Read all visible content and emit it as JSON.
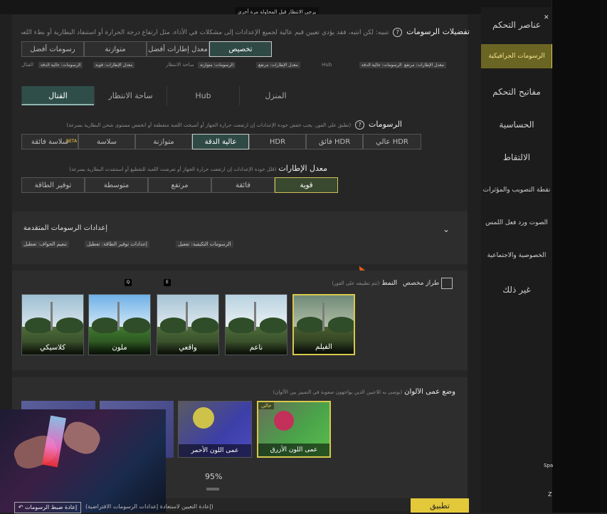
{
  "top": {
    "toast": "يرجى الانتظار قبل المحاولة مرة أخرى"
  },
  "sidebar": {
    "items": [
      {
        "label": "عناصر التحكم",
        "active": false
      },
      {
        "label": "الرسومات الجرافيكية",
        "active": true
      },
      {
        "label": "مفاتيح التحكم",
        "active": false
      },
      {
        "label": "الحساسية",
        "active": false
      },
      {
        "label": "الالتقاط",
        "active": false
      },
      {
        "label": "نقطة التصويب والمؤثرات",
        "active": false
      },
      {
        "label": "الصوت ورد فعل اللمس",
        "active": false
      },
      {
        "label": "الخصوصية والاجتماعية",
        "active": false
      },
      {
        "label": "غير ذلك",
        "active": false
      }
    ]
  },
  "preferences": {
    "title": "تفضيلات الرسومات",
    "warning": "تنبيه: لكن انتبه، فقد يؤدي تعيين قيم عالية لجميع الإعدادات إلى مشكلات في الأداء، مثل ارتفاع درجة الحرارة أو استنفاد البطارية أو بطء اللعب",
    "presets": [
      {
        "label": "تخصيص",
        "on": true
      },
      {
        "label": "معدل إطارات أفضل",
        "on": false
      },
      {
        "label": "متوازنة",
        "on": false
      },
      {
        "label": "رسومات أفضل",
        "on": false
      }
    ],
    "summary_tags": [
      "معدل الإطارات: مرتفع",
      "الرسومات: عالية الدقة",
      "Hub",
      "معدل الإطارات: مرتفع",
      "الرسومات: متوازنة",
      "ساحة الانتظار",
      "معدل الإطارات: قوية",
      "الرسومات: عالية الدقة",
      "القتال"
    ]
  },
  "mode_tabs": [
    {
      "label": "المنزل",
      "on": false
    },
    {
      "label": "Hub",
      "on": false
    },
    {
      "label": "ساحة الانتظار",
      "on": false
    },
    {
      "label": "القتال",
      "on": true
    }
  ],
  "graphics": {
    "title": "الرسومات",
    "hint": "(تطبق على الفور، يجب خفض جودة الإعدادات إن ارتفعت حرارة الجهاز أو أصبحت اللعبة متقطعة أو انخفض مستوى شحن البطارية بسرعة)",
    "options": [
      {
        "label": "عالي HDR",
        "on": false
      },
      {
        "label": "فائق HDR",
        "on": false
      },
      {
        "label": "HDR",
        "on": false
      },
      {
        "label": "عالية الدقة",
        "on": true
      },
      {
        "label": "متوازنة",
        "on": false
      },
      {
        "label": "سلاسة",
        "on": false
      },
      {
        "label": "سلاسة فائقة",
        "on": false,
        "badge": "BETA"
      }
    ]
  },
  "framerate": {
    "title": "معدل الإطارات",
    "hint": "(قلل جودة الإعدادات إن ارتفعت حرارة الجهاز أو تعرضت اللعبة للتقطيع أو استنفدت البطارية بسرعة)",
    "options": [
      {
        "label": "قوية",
        "on": true
      },
      {
        "label": "فائقة",
        "on": false
      },
      {
        "label": "مرتفع",
        "on": false
      },
      {
        "label": "متوسطة",
        "on": false
      },
      {
        "label": "توفير الطاقة",
        "on": false
      }
    ]
  },
  "advanced": {
    "title": "إعدادات الرسومات المتقدمة",
    "tags": [
      "الرسومات التكيفية: تفعيل",
      "إعدادات توفير الطاقة: تعطيل",
      "تنعيم الحواف: تعطيل"
    ]
  },
  "style": {
    "title": "النمط",
    "hint": "(تتم تطبيقه على الفور)",
    "custom_label": "طراز مخصص",
    "key_q": "Q",
    "key_e": "E",
    "thumbs": [
      {
        "label": "الفيلم",
        "selected": true
      },
      {
        "label": "ناعم",
        "selected": false
      },
      {
        "label": "واقعي",
        "selected": false
      },
      {
        "label": "ملون",
        "selected": false
      },
      {
        "label": "كلاسيكي",
        "selected": false
      }
    ]
  },
  "colorblind": {
    "title": "وضع عمى الألوان",
    "hint": "(يوصى به للاعبين الذين يواجهون صعوبة في التمييز بين الألوان)",
    "current_badge": "حالي",
    "options": [
      {
        "label": "عمى اللون الأزرق",
        "selected": true
      },
      {
        "label": "عمى اللون الأحمر",
        "selected": false
      }
    ],
    "brightness": "95%"
  },
  "footer": {
    "reset": "إعادة ضبط الرسومات",
    "reset_hint": "(إعادة التعيين لاستعادة إعدادات الرسومات الافتراضية)",
    "apply": "تطبيق"
  },
  "right_edge": {
    "label1": "Spa",
    "label2": "Z"
  }
}
